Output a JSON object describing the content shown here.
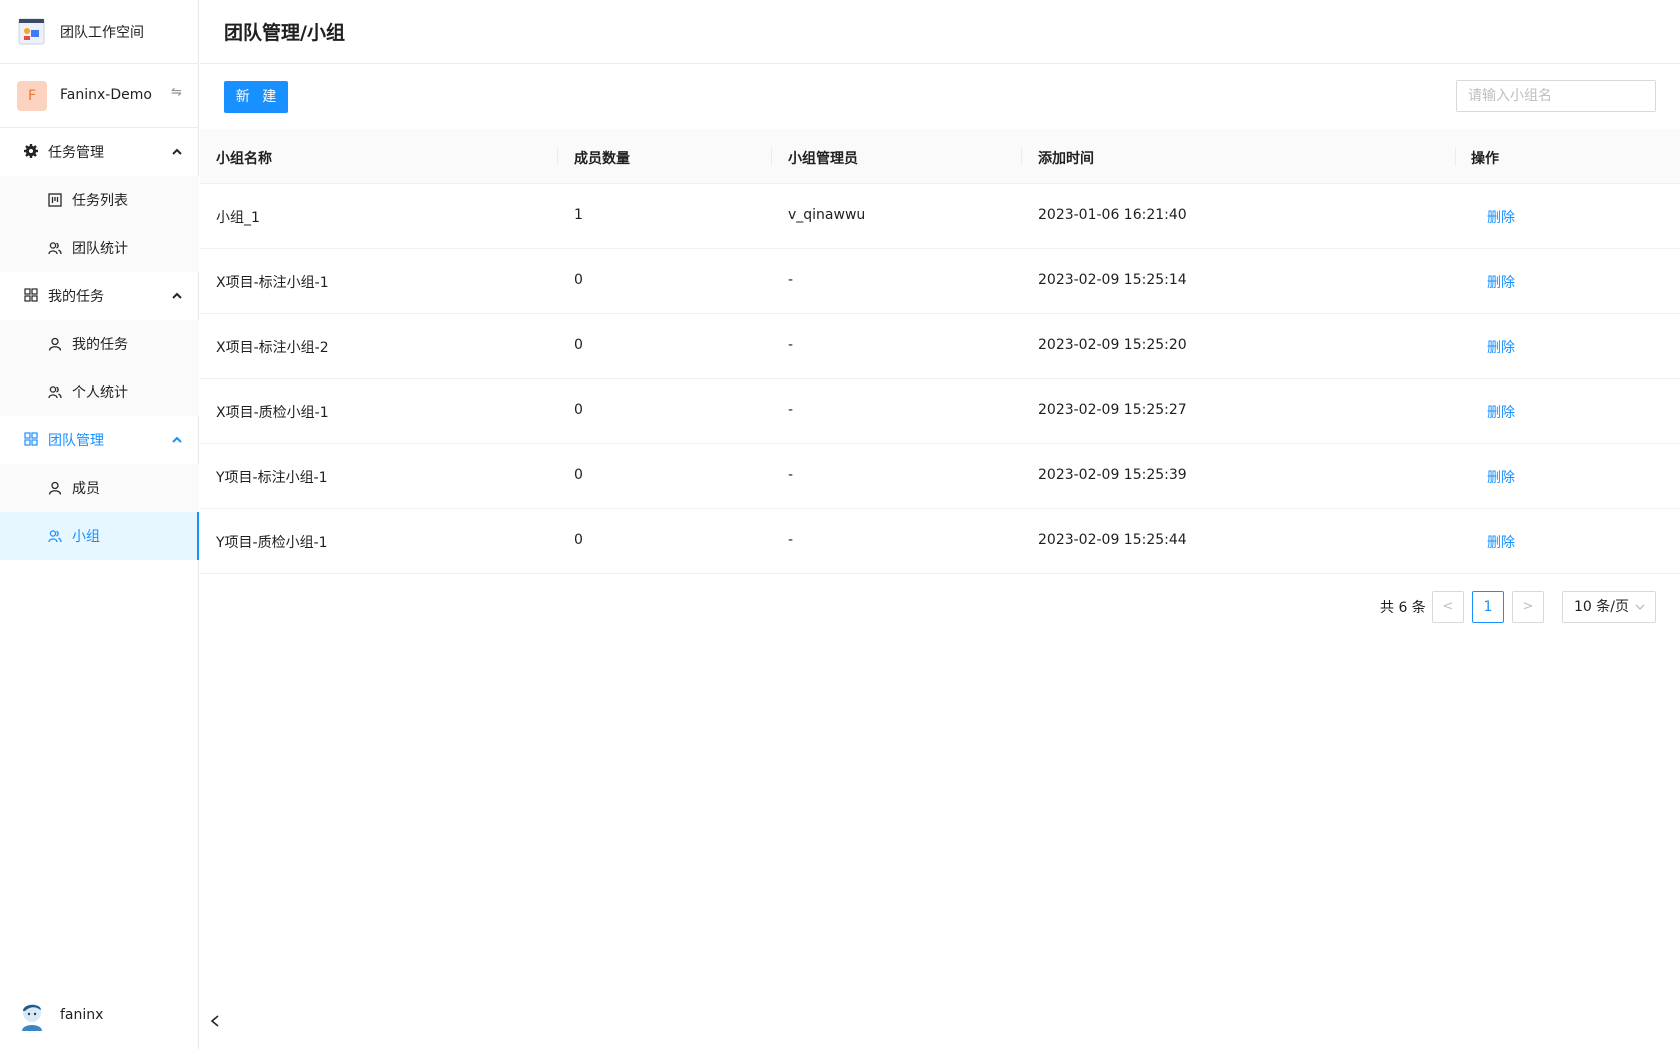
{
  "app": {
    "name": "团队工作空间"
  },
  "team": {
    "avatar_letter": "F",
    "name": "Faninx-Demo",
    "switch_glyph": "⇋"
  },
  "sidebar": {
    "groups": [
      {
        "label": "任务管理",
        "icon": "gear-icon",
        "expanded": true,
        "items": [
          {
            "label": "任务列表",
            "icon": "list-icon"
          },
          {
            "label": "团队统计",
            "icon": "team-stats-icon"
          }
        ]
      },
      {
        "label": "我的任务",
        "icon": "grid-icon",
        "expanded": true,
        "items": [
          {
            "label": "我的任务",
            "icon": "user-icon"
          },
          {
            "label": "个人统计",
            "icon": "personal-stats-icon"
          }
        ]
      },
      {
        "label": "团队管理",
        "icon": "grid-icon",
        "expanded": true,
        "active": true,
        "items": [
          {
            "label": "成员",
            "icon": "user-icon"
          },
          {
            "label": "小组",
            "icon": "group-icon",
            "selected": true
          }
        ]
      }
    ]
  },
  "user": {
    "name": "faninx"
  },
  "page": {
    "title": "团队管理/小组"
  },
  "toolbar": {
    "new_label": "新 建",
    "search_placeholder": "请输入小组名"
  },
  "table": {
    "headers": [
      "小组名称",
      "成员数量",
      "小组管理员",
      "添加时间",
      "操作"
    ],
    "rows": [
      {
        "name": "小组_1",
        "count": "1",
        "admin": "v_qinawwu",
        "time": "2023-01-06 16:21:40",
        "action": "删除"
      },
      {
        "name": "X项目-标注小组-1",
        "count": "0",
        "admin": "-",
        "time": "2023-02-09 15:25:14",
        "action": "删除"
      },
      {
        "name": "X项目-标注小组-2",
        "count": "0",
        "admin": "-",
        "time": "2023-02-09 15:25:20",
        "action": "删除"
      },
      {
        "name": "X项目-质检小组-1",
        "count": "0",
        "admin": "-",
        "time": "2023-02-09 15:25:27",
        "action": "删除"
      },
      {
        "name": "Y项目-标注小组-1",
        "count": "0",
        "admin": "-",
        "time": "2023-02-09 15:25:39",
        "action": "删除"
      },
      {
        "name": "Y项目-质检小组-1",
        "count": "0",
        "admin": "-",
        "time": "2023-02-09 15:25:44",
        "action": "删除"
      }
    ]
  },
  "pagination": {
    "total_text": "共 6 条",
    "current_page": "1",
    "page_size": "10 条/页",
    "prev_glyph": "<",
    "next_glyph": ">"
  },
  "colors": {
    "accent": "#1890ff",
    "selected_bg": "#e6f7ff",
    "team_avatar_bg": "#fbd3bf",
    "team_avatar_text": "#e8743b"
  }
}
